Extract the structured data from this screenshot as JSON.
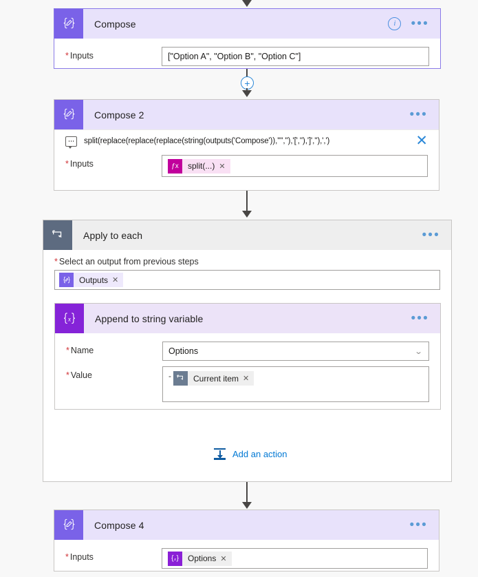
{
  "flow": {
    "cards": [
      {
        "id": "compose-1",
        "title": "Compose",
        "icon": "compose-icon",
        "icon_glyph": "{✐}",
        "field_label": "Inputs",
        "field_value": "[\"Option A\", \"Option B\", \"Option C\"]",
        "has_info": true,
        "selected": true
      },
      {
        "id": "compose-2",
        "title": "Compose 2",
        "icon": "compose-icon",
        "icon_glyph": "{✐}",
        "expression": "split(replace(replace(replace(string(outputs('Compose')),'\"',''),'[',''),']',''),',')",
        "field_label": "Inputs",
        "token_label": "split(...)",
        "token_icon": "fx-icon",
        "token_glyph": "ƒx"
      },
      {
        "id": "apply-to-each",
        "title": "Apply to each",
        "icon": "loop-icon",
        "select_label": "Select an output from previous steps",
        "select_token": "Outputs",
        "select_token_icon": "compose-token-icon",
        "add_action_label": "Add an action",
        "add_action_icon": "insert-icon"
      },
      {
        "id": "append-to-string-variable",
        "title": "Append to string variable",
        "icon": "variable-icon",
        "icon_glyph": "{x}",
        "name_label": "Name",
        "name_value": "Options",
        "value_label": "Value",
        "value_prefix": "-",
        "value_token": "Current item",
        "value_token_icon": "loop-token-icon"
      },
      {
        "id": "compose-4",
        "title": "Compose 4",
        "icon": "compose-icon",
        "icon_glyph": "{✐}",
        "field_label": "Inputs",
        "token_label": "Options",
        "token_icon": "variable-token-icon",
        "token_glyph": "{x}"
      }
    ],
    "icons": {
      "info": "i",
      "ellipsis": "•••",
      "plus": "+",
      "close": "✕",
      "remove": "✕",
      "chevron_down": "⌄"
    },
    "colors": {
      "compose_tile": "#7a62e8",
      "compose_header": "#e8e2fb",
      "variable_tile": "#8523d8",
      "variable_header": "#ece3f8",
      "loop_tile": "#5d6b80",
      "loop_header": "#eeeeee",
      "fx_token": "#c1009c",
      "link_blue": "#0078d4",
      "required_red": "#d13438",
      "connector": "#484644",
      "selected_border": "#8a7ae8"
    }
  }
}
